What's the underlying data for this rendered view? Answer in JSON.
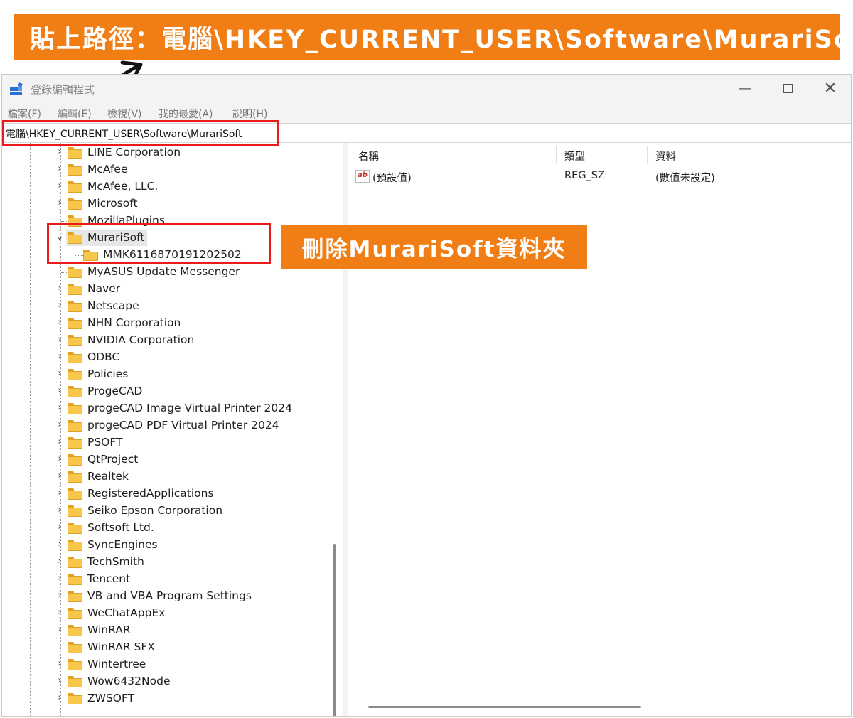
{
  "banner": {
    "text": "貼上路徑：電腦\\HKEY_CURRENT_USER\\Software\\MurariSoft"
  },
  "callout": {
    "text": "刪除MurariSoft資料夾"
  },
  "window": {
    "title": "登錄編輯程式",
    "controls": {
      "minimize": "—",
      "close": "✕"
    }
  },
  "menu": [
    "檔案(F)",
    "編輯(E)",
    "檢視(V)",
    "我的最愛(A)",
    "說明(H)"
  ],
  "address": "電腦\\HKEY_CURRENT_USER\\Software\\MurariSoft",
  "tree": {
    "items": [
      {
        "label": "LINE Corporation",
        "chevron": "›"
      },
      {
        "label": "McAfee",
        "chevron": "›"
      },
      {
        "label": "McAfee, LLC.",
        "chevron": "›"
      },
      {
        "label": "Microsoft",
        "chevron": "›"
      },
      {
        "label": "MozillaPlugins",
        "chevron": ""
      },
      {
        "label": "MurariSoft",
        "chevron": "⌄"
      },
      {
        "label": "MMK6116870191202502",
        "chevron": ""
      },
      {
        "label": "MyASUS Update Messenger",
        "chevron": ""
      },
      {
        "label": "Naver",
        "chevron": "›"
      },
      {
        "label": "Netscape",
        "chevron": "›"
      },
      {
        "label": "NHN Corporation",
        "chevron": "›"
      },
      {
        "label": "NVIDIA Corporation",
        "chevron": "›"
      },
      {
        "label": "ODBC",
        "chevron": "›"
      },
      {
        "label": "Policies",
        "chevron": "›"
      },
      {
        "label": "ProgeCAD",
        "chevron": "›"
      },
      {
        "label": "progeCAD Image Virtual Printer 2024",
        "chevron": "›"
      },
      {
        "label": "progeCAD PDF Virtual Printer 2024",
        "chevron": "›"
      },
      {
        "label": "PSOFT",
        "chevron": "›"
      },
      {
        "label": "QtProject",
        "chevron": "›"
      },
      {
        "label": "Realtek",
        "chevron": "›"
      },
      {
        "label": "RegisteredApplications",
        "chevron": "›"
      },
      {
        "label": "Seiko Epson Corporation",
        "chevron": "›"
      },
      {
        "label": "Softsoft Ltd.",
        "chevron": "›"
      },
      {
        "label": "SyncEngines",
        "chevron": "›"
      },
      {
        "label": "TechSmith",
        "chevron": "›"
      },
      {
        "label": "Tencent",
        "chevron": "›"
      },
      {
        "label": "VB and VBA Program Settings",
        "chevron": "›"
      },
      {
        "label": "WeChatAppEx",
        "chevron": "›"
      },
      {
        "label": "WinRAR",
        "chevron": "›"
      },
      {
        "label": "WinRAR SFX",
        "chevron": ""
      },
      {
        "label": "Wintertree",
        "chevron": "›"
      },
      {
        "label": "Wow6432Node",
        "chevron": "›"
      },
      {
        "label": "ZWSOFT",
        "chevron": "›"
      }
    ]
  },
  "values": {
    "headers": {
      "name": "名稱",
      "type": "類型",
      "data": "資料"
    },
    "rows": [
      {
        "icon": "ab",
        "name": "(預設值)",
        "type": "REG_SZ",
        "data": "(數值未設定)"
      }
    ]
  },
  "colors": {
    "accent_orange": "#f07e14",
    "highlight_red": "#e81c1c",
    "folder_yellow": "#f8c64a"
  },
  "icons": {
    "app": "registry-editor-icon",
    "folder": "folder-icon",
    "value": "string-value-icon",
    "arrow": "curved-arrow-icon"
  }
}
